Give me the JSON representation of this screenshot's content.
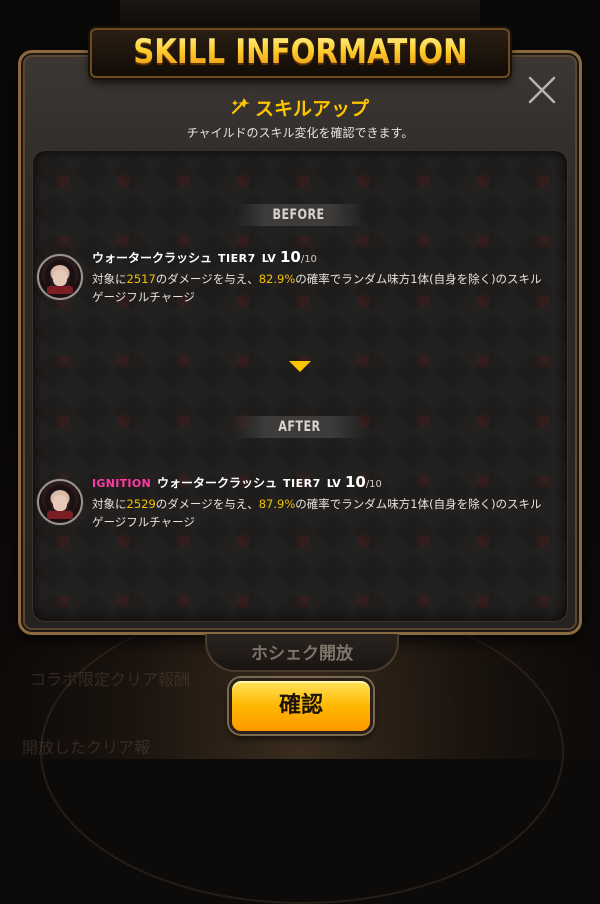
{
  "header": {
    "title": "SKILL INFORMATION"
  },
  "dialog": {
    "subtitle": "スキルアップ",
    "description": "チャイルドのスキル変化を確認できます。",
    "before": {
      "section_label": "BEFORE",
      "skill_name": "ウォータークラッシュ",
      "tier": "TIER7",
      "level_prefix": "LV",
      "level": "10",
      "level_max": "/10",
      "desc_prefix": "対象に",
      "damage": "2517",
      "desc_mid": "のダメージを与え、",
      "chance": "82.9%",
      "desc_suffix": "の確率でランダム味方1体(自身を除く)のスキル",
      "desc_line2": "ゲージフルチャージ"
    },
    "after": {
      "section_label": "AFTER",
      "ignition": "IGNITION",
      "skill_name": "ウォータークラッシュ",
      "tier": "TIER7",
      "level_prefix": "LV",
      "level": "10",
      "level_max": "/10",
      "desc_prefix": "対象に",
      "damage": "2529",
      "desc_mid": "のダメージを与え、",
      "chance": "87.9%",
      "desc_suffix": "の確率でランダム味方1体(自身を除く)のスキル",
      "desc_line2": "ゲージフルチャージ"
    },
    "confirm_label": "確認"
  },
  "background": {
    "tab_label": "ホシェク開放",
    "faint_text_1": "コラボ限定クリア報酬",
    "faint_text_2": "開放したクリア報"
  },
  "icons": {
    "close": "close-icon",
    "spark": "sparkle-icon",
    "arrow": "arrow-down-icon",
    "avatar": "character-avatar"
  },
  "colors": {
    "accent": "#ffc400",
    "ignition": "#ff3aa8",
    "highlight": "#f2c000",
    "panel_border": "#8a6a3e"
  }
}
